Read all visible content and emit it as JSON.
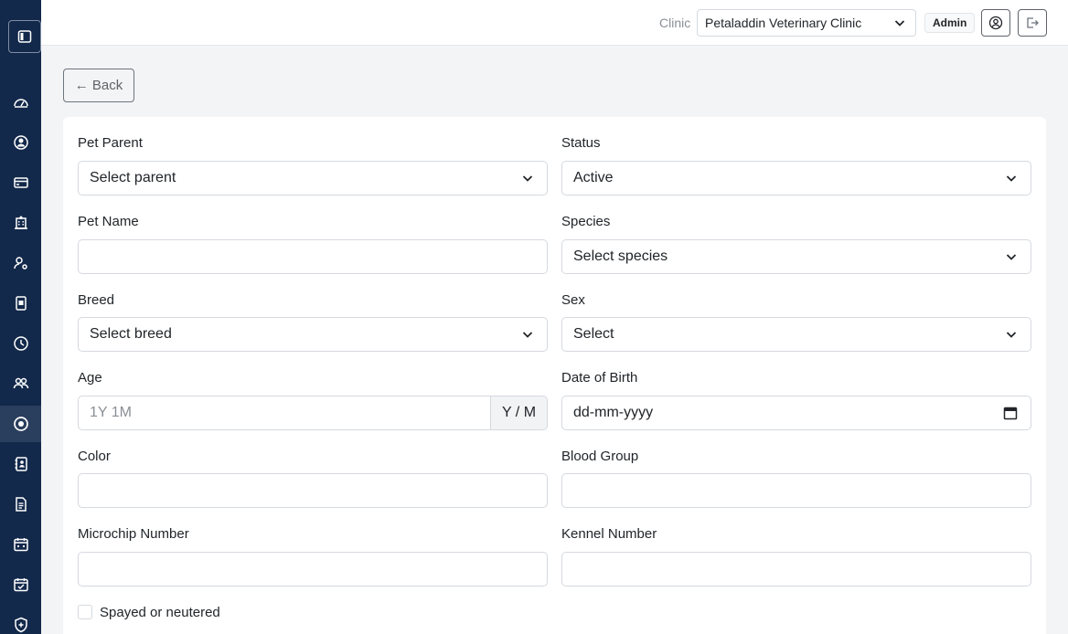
{
  "sidebar": {
    "toggle_icon": "sidebar-toggle-icon",
    "items": [
      {
        "icon": "dashboard-gauge-icon"
      },
      {
        "icon": "user-circle-icon"
      },
      {
        "icon": "credit-card-icon"
      },
      {
        "icon": "hospital-building-icon"
      },
      {
        "icon": "user-settings-icon"
      },
      {
        "icon": "id-badge-icon"
      },
      {
        "icon": "clock-history-icon"
      },
      {
        "icon": "people-group-icon"
      },
      {
        "icon": "record-circle-icon",
        "active": true
      },
      {
        "icon": "contacts-book-icon"
      },
      {
        "icon": "document-icon"
      },
      {
        "icon": "calendar-icon"
      },
      {
        "icon": "calendar-check-icon"
      },
      {
        "icon": "shield-icon"
      }
    ]
  },
  "header": {
    "clinic_label": "Clinic",
    "clinic_value": "Petaladdin Veterinary Clinic",
    "role_badge": "Admin"
  },
  "back_label": "← Back",
  "form": {
    "pet_parent": {
      "label": "Pet Parent",
      "value": "Select parent"
    },
    "status": {
      "label": "Status",
      "value": "Active"
    },
    "pet_name": {
      "label": "Pet Name",
      "value": "",
      "placeholder": ""
    },
    "species": {
      "label": "Species",
      "value": "Select species"
    },
    "breed": {
      "label": "Breed",
      "value": "Select breed"
    },
    "sex": {
      "label": "Sex",
      "value": "Select"
    },
    "age": {
      "label": "Age",
      "placeholder": "1Y 1M",
      "addon": "Y / M"
    },
    "dob": {
      "label": "Date of Birth",
      "value": "dd-mm-yyyy"
    },
    "color": {
      "label": "Color",
      "placeholder": ""
    },
    "blood_group": {
      "label": "Blood Group",
      "placeholder": ""
    },
    "microchip": {
      "label": "Microchip Number",
      "placeholder": ""
    },
    "kennel": {
      "label": "Kennel Number",
      "placeholder": ""
    },
    "spayed": {
      "label": "Spayed or neutered",
      "checked": false
    }
  },
  "colors": {
    "sidebar": "#13294b",
    "sidebar_active": "#2a3e5e",
    "border": "#d5d9de"
  }
}
